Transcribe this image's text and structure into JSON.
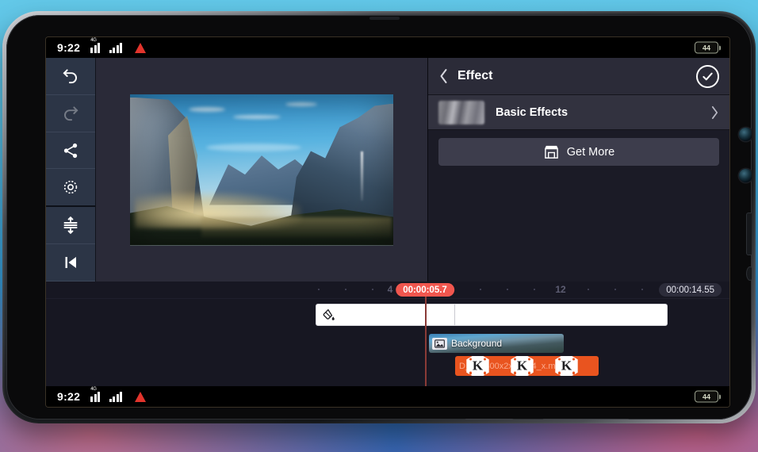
{
  "status_bar": {
    "time": "9:22",
    "network_label": "4G",
    "battery_level": "44",
    "icons": [
      "signal-bars-icon",
      "signal-bars-icon",
      "location-arrow-icon",
      "battery-icon"
    ]
  },
  "left_toolbar": {
    "items": [
      {
        "name": "undo-button",
        "icon": "undo-icon",
        "enabled": true
      },
      {
        "name": "redo-button",
        "icon": "redo-icon",
        "enabled": false
      },
      {
        "name": "share-button",
        "icon": "share-icon",
        "enabled": true
      },
      {
        "name": "settings-button",
        "icon": "gear-icon",
        "enabled": true
      },
      {
        "name": "expand-timeline-button",
        "icon": "expand-rows-icon",
        "enabled": true
      },
      {
        "name": "jump-to-start-button",
        "icon": "skip-to-start-icon",
        "enabled": true
      }
    ]
  },
  "preview": {
    "name": "video-preview",
    "description": "Yosemite Valley landscape with granite cliffs, blue sky and forest"
  },
  "effect_panel": {
    "back_icon": "chevron-left-icon",
    "title": "Effect",
    "confirm_icon": "check-circle-icon",
    "rows": [
      {
        "label": "Basic Effects",
        "chevron_icon": "chevron-right-icon",
        "thumb": "blurred-effect-thumbnail"
      }
    ],
    "get_more": {
      "label": "Get More",
      "icon": "store-icon"
    }
  },
  "timeline": {
    "playhead_time": "00:00:05.7",
    "total_duration": "00:00:14.55",
    "ruler_labels": [
      "4",
      "12"
    ],
    "tracks": [
      {
        "name": "white-layer-clip",
        "icon": "paint-bucket-icon",
        "label": ""
      },
      {
        "name": "background-video-clip",
        "icon": "image-icon",
        "label": "Background"
      },
      {
        "name": "audio-clip",
        "label": "D_a02400x2x_1104_x.mp3",
        "logo_letter": "K",
        "logo_count": 3,
        "color": "#e9541f"
      }
    ]
  },
  "colors": {
    "accent_red": "#f0564e",
    "toolbar_bg": "#2c3546",
    "panel_bg": "#1b1b26",
    "audio_orange": "#e9541f",
    "background_top": "#63c8e8",
    "background_bottom": "#2a74c4"
  }
}
